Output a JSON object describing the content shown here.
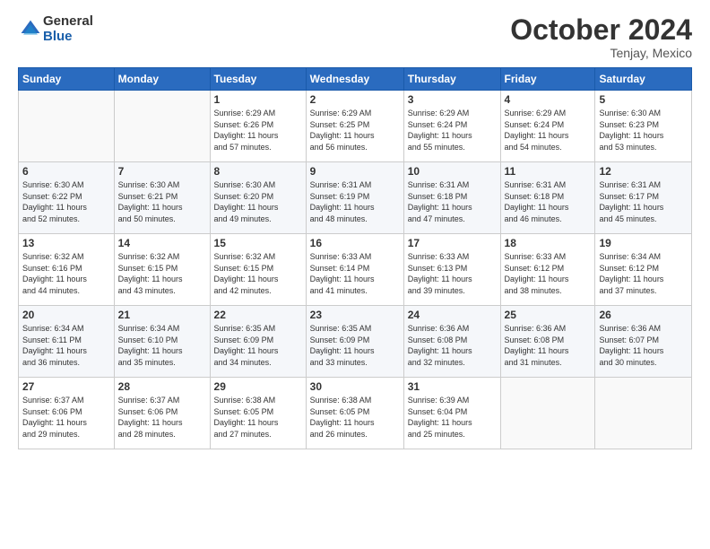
{
  "header": {
    "logo_general": "General",
    "logo_blue": "Blue",
    "month_title": "October 2024",
    "location": "Tenjay, Mexico"
  },
  "weekdays": [
    "Sunday",
    "Monday",
    "Tuesday",
    "Wednesday",
    "Thursday",
    "Friday",
    "Saturday"
  ],
  "weeks": [
    [
      {
        "day": "",
        "info": ""
      },
      {
        "day": "",
        "info": ""
      },
      {
        "day": "1",
        "info": "Sunrise: 6:29 AM\nSunset: 6:26 PM\nDaylight: 11 hours\nand 57 minutes."
      },
      {
        "day": "2",
        "info": "Sunrise: 6:29 AM\nSunset: 6:25 PM\nDaylight: 11 hours\nand 56 minutes."
      },
      {
        "day": "3",
        "info": "Sunrise: 6:29 AM\nSunset: 6:24 PM\nDaylight: 11 hours\nand 55 minutes."
      },
      {
        "day": "4",
        "info": "Sunrise: 6:29 AM\nSunset: 6:24 PM\nDaylight: 11 hours\nand 54 minutes."
      },
      {
        "day": "5",
        "info": "Sunrise: 6:30 AM\nSunset: 6:23 PM\nDaylight: 11 hours\nand 53 minutes."
      }
    ],
    [
      {
        "day": "6",
        "info": "Sunrise: 6:30 AM\nSunset: 6:22 PM\nDaylight: 11 hours\nand 52 minutes."
      },
      {
        "day": "7",
        "info": "Sunrise: 6:30 AM\nSunset: 6:21 PM\nDaylight: 11 hours\nand 50 minutes."
      },
      {
        "day": "8",
        "info": "Sunrise: 6:30 AM\nSunset: 6:20 PM\nDaylight: 11 hours\nand 49 minutes."
      },
      {
        "day": "9",
        "info": "Sunrise: 6:31 AM\nSunset: 6:19 PM\nDaylight: 11 hours\nand 48 minutes."
      },
      {
        "day": "10",
        "info": "Sunrise: 6:31 AM\nSunset: 6:18 PM\nDaylight: 11 hours\nand 47 minutes."
      },
      {
        "day": "11",
        "info": "Sunrise: 6:31 AM\nSunset: 6:18 PM\nDaylight: 11 hours\nand 46 minutes."
      },
      {
        "day": "12",
        "info": "Sunrise: 6:31 AM\nSunset: 6:17 PM\nDaylight: 11 hours\nand 45 minutes."
      }
    ],
    [
      {
        "day": "13",
        "info": "Sunrise: 6:32 AM\nSunset: 6:16 PM\nDaylight: 11 hours\nand 44 minutes."
      },
      {
        "day": "14",
        "info": "Sunrise: 6:32 AM\nSunset: 6:15 PM\nDaylight: 11 hours\nand 43 minutes."
      },
      {
        "day": "15",
        "info": "Sunrise: 6:32 AM\nSunset: 6:15 PM\nDaylight: 11 hours\nand 42 minutes."
      },
      {
        "day": "16",
        "info": "Sunrise: 6:33 AM\nSunset: 6:14 PM\nDaylight: 11 hours\nand 41 minutes."
      },
      {
        "day": "17",
        "info": "Sunrise: 6:33 AM\nSunset: 6:13 PM\nDaylight: 11 hours\nand 39 minutes."
      },
      {
        "day": "18",
        "info": "Sunrise: 6:33 AM\nSunset: 6:12 PM\nDaylight: 11 hours\nand 38 minutes."
      },
      {
        "day": "19",
        "info": "Sunrise: 6:34 AM\nSunset: 6:12 PM\nDaylight: 11 hours\nand 37 minutes."
      }
    ],
    [
      {
        "day": "20",
        "info": "Sunrise: 6:34 AM\nSunset: 6:11 PM\nDaylight: 11 hours\nand 36 minutes."
      },
      {
        "day": "21",
        "info": "Sunrise: 6:34 AM\nSunset: 6:10 PM\nDaylight: 11 hours\nand 35 minutes."
      },
      {
        "day": "22",
        "info": "Sunrise: 6:35 AM\nSunset: 6:09 PM\nDaylight: 11 hours\nand 34 minutes."
      },
      {
        "day": "23",
        "info": "Sunrise: 6:35 AM\nSunset: 6:09 PM\nDaylight: 11 hours\nand 33 minutes."
      },
      {
        "day": "24",
        "info": "Sunrise: 6:36 AM\nSunset: 6:08 PM\nDaylight: 11 hours\nand 32 minutes."
      },
      {
        "day": "25",
        "info": "Sunrise: 6:36 AM\nSunset: 6:08 PM\nDaylight: 11 hours\nand 31 minutes."
      },
      {
        "day": "26",
        "info": "Sunrise: 6:36 AM\nSunset: 6:07 PM\nDaylight: 11 hours\nand 30 minutes."
      }
    ],
    [
      {
        "day": "27",
        "info": "Sunrise: 6:37 AM\nSunset: 6:06 PM\nDaylight: 11 hours\nand 29 minutes."
      },
      {
        "day": "28",
        "info": "Sunrise: 6:37 AM\nSunset: 6:06 PM\nDaylight: 11 hours\nand 28 minutes."
      },
      {
        "day": "29",
        "info": "Sunrise: 6:38 AM\nSunset: 6:05 PM\nDaylight: 11 hours\nand 27 minutes."
      },
      {
        "day": "30",
        "info": "Sunrise: 6:38 AM\nSunset: 6:05 PM\nDaylight: 11 hours\nand 26 minutes."
      },
      {
        "day": "31",
        "info": "Sunrise: 6:39 AM\nSunset: 6:04 PM\nDaylight: 11 hours\nand 25 minutes."
      },
      {
        "day": "",
        "info": ""
      },
      {
        "day": "",
        "info": ""
      }
    ]
  ]
}
